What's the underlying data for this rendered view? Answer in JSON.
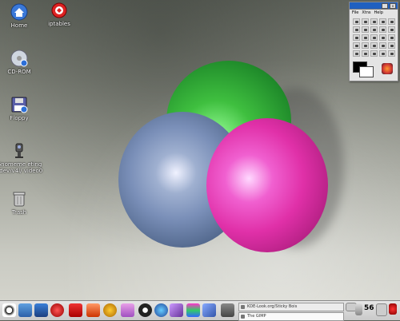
{
  "desktop": {
    "icons": [
      {
        "label": "Home",
        "icon": "home-icon"
      },
      {
        "label": "iptables",
        "icon": "iptables-icon"
      },
      {
        "label": "CD-ROM",
        "icon": "cdrom-icon"
      },
      {
        "label": "Floppy",
        "icon": "floppy-icon"
      },
      {
        "label": "Gnomeme eting / dev/v4l/ video0",
        "icon": "webcam-icon"
      },
      {
        "label": "Trash",
        "icon": "trash-icon"
      }
    ]
  },
  "gimp_toolbox": {
    "menus": [
      "File",
      "Xtns",
      "Help"
    ],
    "foreground_color": "#000000",
    "background_color": "#ffffff"
  },
  "taskbar": {
    "tasks": [
      {
        "label": "KDE-Look.org/Sticky Bois",
        "active": false
      },
      {
        "label": "The GIMP",
        "active": true
      }
    ],
    "clock": "56"
  },
  "colors": {
    "sphere_green": "#3fbf3f",
    "sphere_blue": "#7a8fb8",
    "sphere_pink": "#e030a8"
  }
}
